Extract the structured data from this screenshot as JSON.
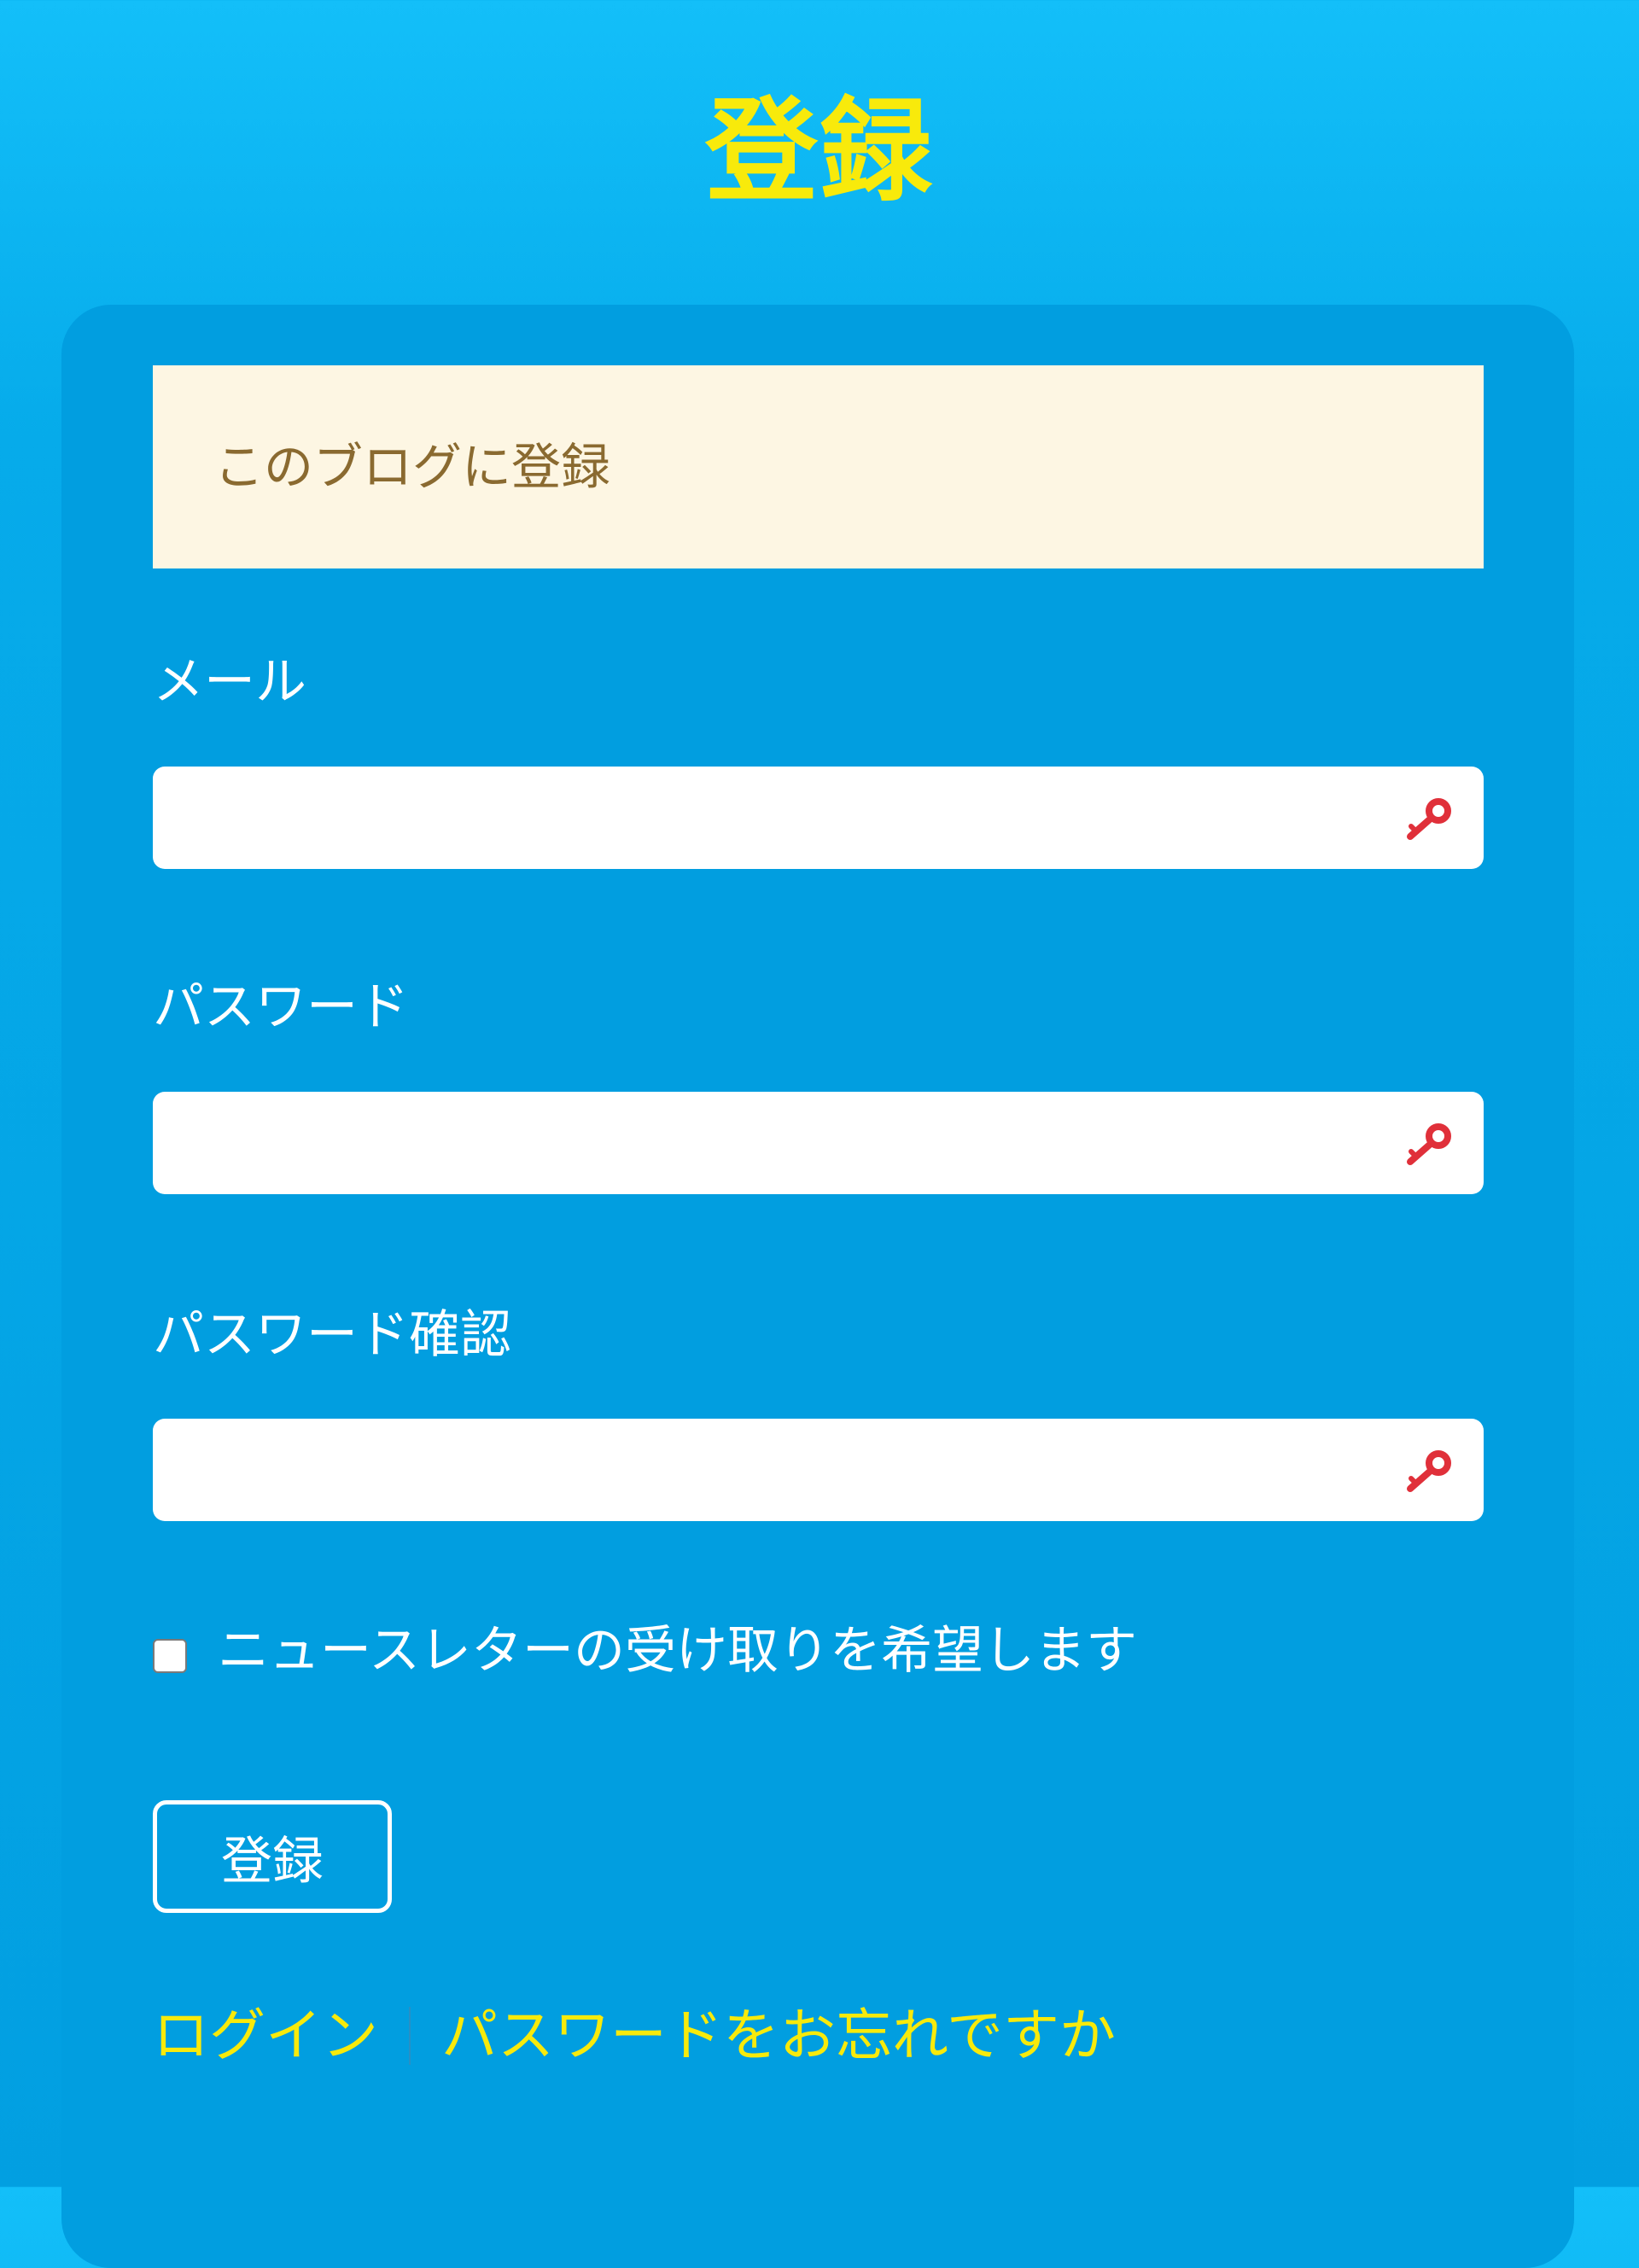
{
  "page": {
    "title": "登録"
  },
  "notice": {
    "text": "このブログに登録"
  },
  "form": {
    "email": {
      "label": "メール",
      "value": "",
      "icon": "key-icon"
    },
    "password": {
      "label": "パスワード",
      "value": "",
      "icon": "key-icon"
    },
    "password_confirm": {
      "label": "パスワード確認",
      "value": "",
      "icon": "key-icon"
    },
    "newsletter": {
      "label": "ニュースレターの受け取りを希望します",
      "checked": false
    },
    "submit_label": "登録"
  },
  "links": {
    "login": "ログイン",
    "forgot_password": "パスワードをお忘れですか"
  },
  "colors": {
    "background": "#029fe1",
    "title": "#f8ea0b",
    "link": "#f8ea0b",
    "notice_bg": "#fdf6e3",
    "notice_text": "#8a6a30",
    "key_icon": "#e0303a"
  }
}
